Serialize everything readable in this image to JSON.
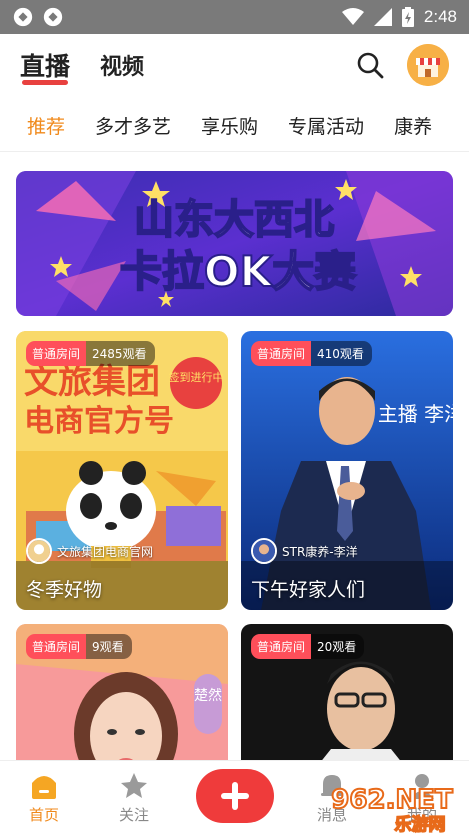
{
  "status_bar": {
    "time": "2:48"
  },
  "header": {
    "tabs": [
      {
        "label": "直播"
      },
      {
        "label": "视频"
      }
    ]
  },
  "categories": [
    "推荐",
    "多才多艺",
    "享乐购",
    "专属活动",
    "康养"
  ],
  "banner": {
    "line1": "山东大西北",
    "line2": "卡拉OK大赛"
  },
  "cards": [
    {
      "room": "普通房间",
      "views": "2485观看",
      "author": "文旅集团电商官网",
      "title": "冬季好物",
      "art_line1": "文旅集团",
      "art_line2": "电商官方号",
      "sign_badge": "签到进行中"
    },
    {
      "room": "普通房间",
      "views": "410观看",
      "author": "STR康养-李洋",
      "title": "下午好家人们",
      "art_side": "主播 李洋"
    },
    {
      "room": "普通房间",
      "views": "9观看",
      "art_side": "楚然"
    },
    {
      "room": "普通房间",
      "views": "20观看"
    }
  ],
  "bottom_nav": {
    "items": [
      {
        "label": "首页"
      },
      {
        "label": "关注"
      },
      {
        "label": "消息"
      },
      {
        "label": "我的"
      }
    ]
  },
  "watermark": {
    "brand": "962.NET",
    "sub": "乐游网"
  },
  "colors": {
    "accent": "#f08a1c",
    "red": "#ef3b3b",
    "badge": "#ff4f5a"
  }
}
